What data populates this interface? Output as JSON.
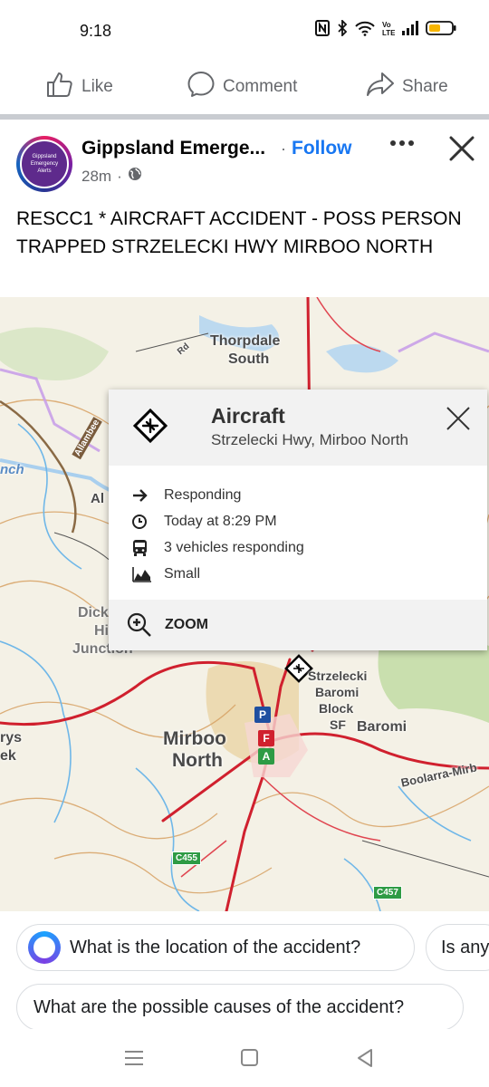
{
  "status_bar": {
    "time": "9:18"
  },
  "actions": {
    "like": "Like",
    "comment": "Comment",
    "share": "Share"
  },
  "post": {
    "page_name": "Gippsland Emerge...",
    "follow_dot": "·",
    "follow": "Follow",
    "time": "28m",
    "meta_dot": "·",
    "avatar_text": [
      "Gippsland",
      "Emergency",
      "Alerts"
    ],
    "text": "RESCC1 * AIRCRAFT ACCIDENT - POSS PERSON TRAPPED STRZELECKI HWY MIRBOO NORTH"
  },
  "map": {
    "labels": {
      "thorpdale": "Thorpdale",
      "south": "South",
      "mirboo": "Mirboo",
      "north": "North",
      "strzelecki": "Strzelecki",
      "baromi_small": "Baromi",
      "block": "Block",
      "sf": "SF",
      "baromi": "Baromi",
      "boolarra": "Boolarra-Mirb",
      "dick": "Dick",
      "hi": "Hi",
      "junction": "Junction",
      "al": "Al",
      "rys": "rys",
      "ek": "ek",
      "nch": "nch",
      "rd": "Rd",
      "allambee": "Allambee"
    },
    "road_badges": {
      "c455": "C455",
      "c457": "C457"
    },
    "poi": {
      "p": "P",
      "f": "F",
      "a": "A"
    }
  },
  "popup": {
    "title": "Aircraft",
    "location": "Strzelecki Hwy, Mirboo North",
    "status": "Responding",
    "time": "Today at 8:29 PM",
    "vehicles": "3 vehicles responding",
    "size": "Small",
    "zoom": "ZOOM"
  },
  "suggestions": [
    "What is the location of the accident?",
    "Is any",
    "What are the possible causes of the accident?"
  ]
}
